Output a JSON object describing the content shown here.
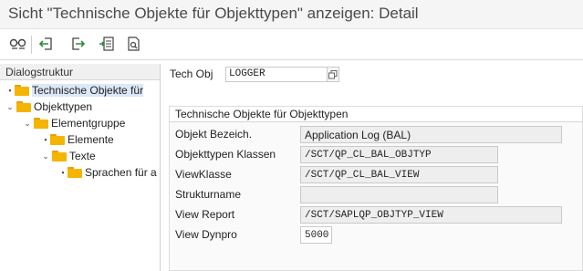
{
  "window": {
    "title": "Sicht \"Technische Objekte für Objekttypen\" anzeigen: Detail"
  },
  "toolbar": {
    "buttons": [
      {
        "icon": "glasses-display-icon"
      },
      {
        "icon": "arrow-back-icon"
      },
      {
        "icon": "arrow-forward-icon"
      },
      {
        "icon": "select-all-icon"
      },
      {
        "icon": "document-find-icon"
      }
    ]
  },
  "sidebar": {
    "header": "Dialogstruktur",
    "items": [
      {
        "label": "Technische Objekte für",
        "selected": true
      },
      {
        "label": "Objekttypen",
        "expanded": true
      },
      {
        "label": "Elementgruppe",
        "expanded": true
      },
      {
        "label": "Elemente"
      },
      {
        "label": "Texte",
        "expanded": true
      },
      {
        "label": "Sprachen für a"
      }
    ]
  },
  "main": {
    "tech_obj_label": "Tech Obj",
    "tech_obj_value": "LOGGER",
    "group_title": "Technische Objekte für Objekttypen",
    "fields": [
      {
        "label": "Objekt Bezeich.",
        "value": "Application Log (BAL)"
      },
      {
        "label": "Objekttypen Klassen",
        "value": "/SCT/QP_CL_BAL_OBJTYP"
      },
      {
        "label": "ViewKlasse",
        "value": "/SCT/QP_CL_BAL_VIEW"
      },
      {
        "label": "Strukturname",
        "value": ""
      },
      {
        "label": "View Report",
        "value": "/SCT/SAPLQP_OBJTYP_VIEW"
      },
      {
        "label": "View Dynpro",
        "value": "5000"
      }
    ]
  },
  "colors": {
    "folder": "#f5b400",
    "toolbar_green": "#2e8b3a",
    "selection": "#dbe8f7"
  }
}
